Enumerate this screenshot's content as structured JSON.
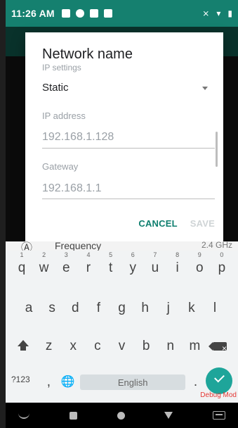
{
  "status_bar": {
    "time": "11:26 AM",
    "debug_text": "Debug Mod"
  },
  "dialog": {
    "title": "Network name",
    "ip_settings_label": "IP settings",
    "ip_settings_value": "Static",
    "ip_address_label": "IP address",
    "ip_address_value": "192.168.1.128",
    "gateway_label": "Gateway",
    "gateway_value": "192.168.1.1",
    "cancel_label": "CANCEL",
    "save_label": "SAVE"
  },
  "background": {
    "frequency_label": "Frequency",
    "frequency_value": "2.4 GHz"
  },
  "keyboard": {
    "row1": [
      "q",
      "w",
      "e",
      "r",
      "t",
      "y",
      "u",
      "i",
      "o",
      "p"
    ],
    "row1_hints": [
      "1",
      "2",
      "3",
      "4",
      "5",
      "6",
      "7",
      "8",
      "9",
      "0"
    ],
    "row2": [
      "a",
      "s",
      "d",
      "f",
      "g",
      "h",
      "j",
      "k",
      "l"
    ],
    "row3": [
      "z",
      "x",
      "c",
      "v",
      "b",
      "n",
      "m"
    ],
    "sym_label": "?123",
    "comma": ",",
    "space_label": "English",
    "period": "."
  },
  "icons": {
    "globe": "🌐"
  }
}
